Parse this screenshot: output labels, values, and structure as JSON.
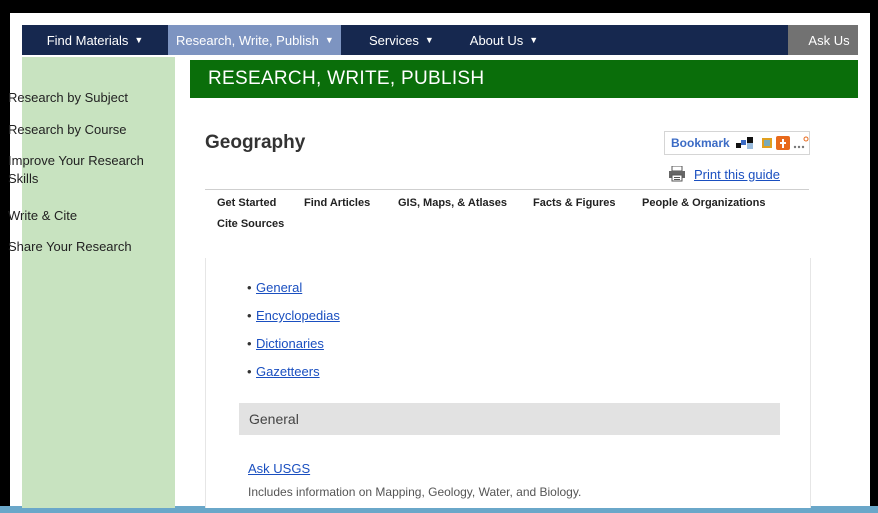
{
  "nav": {
    "items": [
      {
        "label": "Find Materials"
      },
      {
        "label": "Research, Write, Publish"
      },
      {
        "label": "Services"
      },
      {
        "label": "About Us"
      }
    ],
    "ask": "Ask Us",
    "caret": "▼"
  },
  "sidebar": {
    "items": [
      {
        "label": "Research by Subject"
      },
      {
        "label": "Research by Course"
      },
      {
        "label": "Improve Your Research Skills"
      },
      {
        "label": "Write & Cite"
      },
      {
        "label": "Share Your Research"
      }
    ]
  },
  "banner": {
    "title": "RESEARCH, WRITE, PUBLISH"
  },
  "guide": {
    "title": "Geography",
    "bookmark_label": "Bookmark",
    "print_label": "Print this guide"
  },
  "tabs": [
    {
      "label": "Get Started"
    },
    {
      "label": "Find Articles"
    },
    {
      "label": "GIS, Maps, & Atlases"
    },
    {
      "label": "Facts & Figures"
    },
    {
      "label": "People & Organizations"
    },
    {
      "label": "Cite Sources"
    }
  ],
  "content": {
    "links": [
      {
        "label": "General"
      },
      {
        "label": "Encyclopedias"
      },
      {
        "label": "Dictionaries"
      },
      {
        "label": "Gazetteers"
      }
    ],
    "section_title": "General",
    "resource": {
      "title": "Ask USGS",
      "description": "Includes information on Mapping, Geology, Water, and Biology."
    }
  },
  "colors": {
    "nav_bg": "#16284f",
    "nav_active": "#7d94c1",
    "sidebar_bg": "#c8e3c0",
    "banner_bg": "#0a6e0a",
    "link": "#1a4fc0"
  }
}
